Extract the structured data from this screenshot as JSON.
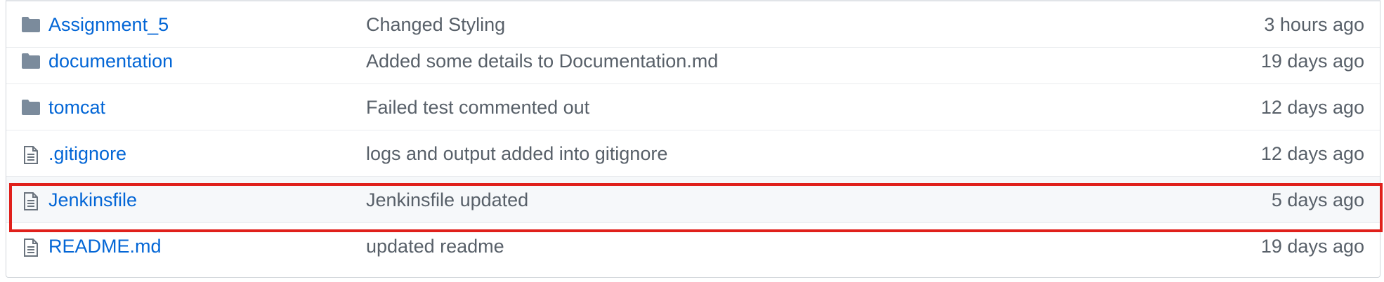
{
  "files": [
    {
      "name": "Assignment_5",
      "type": "folder",
      "icon": "folder-icon",
      "message": "Changed Styling",
      "age": "3 hours ago"
    },
    {
      "name": "documentation",
      "type": "folder",
      "icon": "folder-icon",
      "message": "Added some details to Documentation.md",
      "age": "19 days ago"
    },
    {
      "name": "tomcat",
      "type": "folder",
      "icon": "folder-icon",
      "message": "Failed test commented out",
      "age": "12 days ago"
    },
    {
      "name": ".gitignore",
      "type": "file",
      "icon": "file-text-icon",
      "message": "logs and output added into gitignore",
      "age": "12 days ago"
    },
    {
      "name": "Jenkinsfile",
      "type": "file",
      "icon": "file-text-icon",
      "message": "Jenkinsfile updated",
      "age": "5 days ago"
    },
    {
      "name": "README.md",
      "type": "file",
      "icon": "file-text-icon",
      "message": "updated readme",
      "age": "19 days ago"
    }
  ],
  "colors": {
    "link": "#0366d6",
    "muted": "#586069",
    "folder_icon": "#79b8ff",
    "highlight_border": "#e0201b"
  }
}
